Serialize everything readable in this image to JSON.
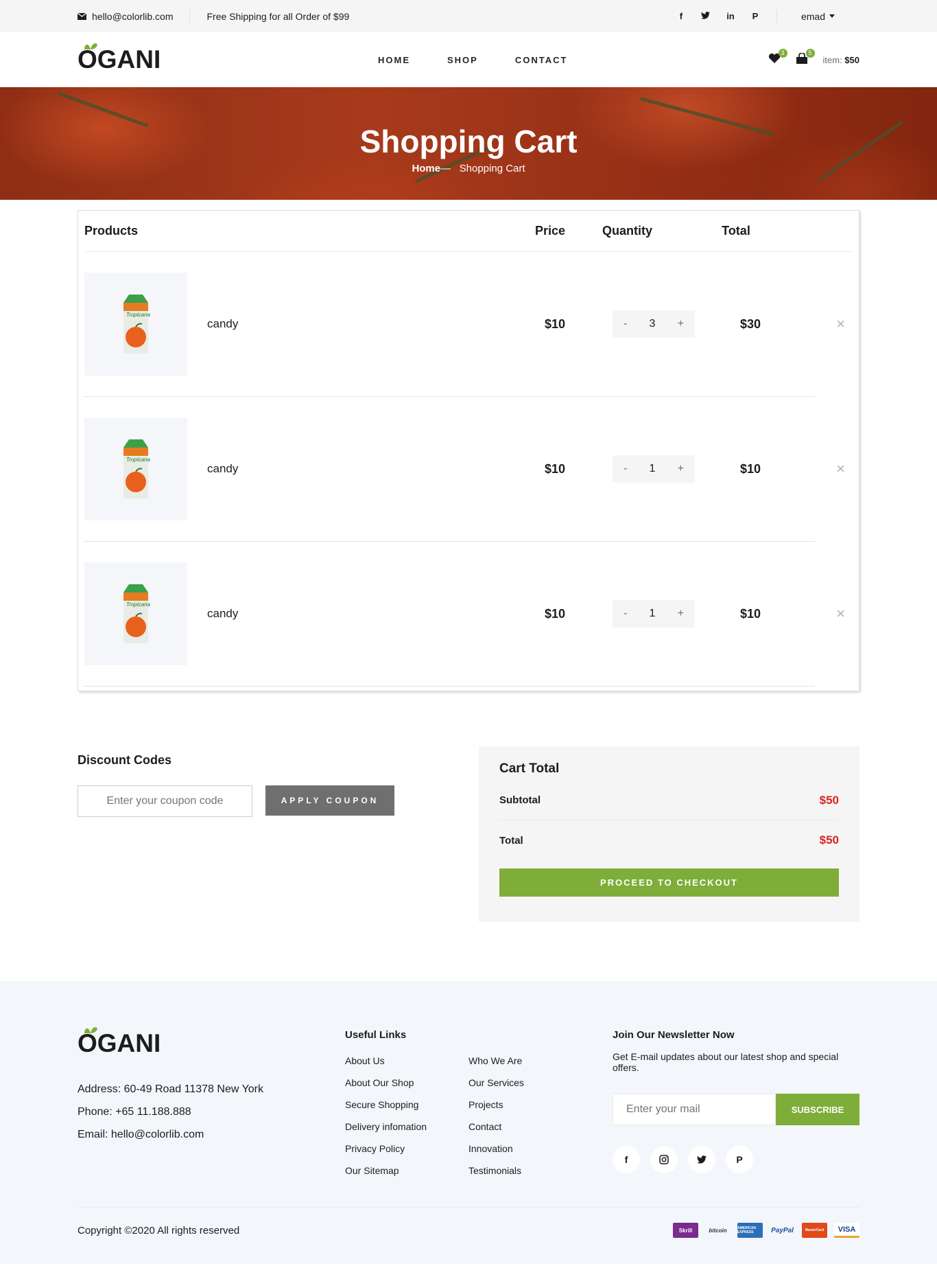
{
  "topbar": {
    "email": "hello@colorlib.com",
    "shipping": "Free Shipping for all Order of $99",
    "social_icons": [
      "facebook-icon",
      "twitter-icon",
      "linkedin-icon",
      "pinterest-icon"
    ],
    "user": "emad"
  },
  "header": {
    "logo": "OGANI",
    "nav": [
      "HOME",
      "SHOP",
      "CONTACT"
    ],
    "wishlist_count": "3",
    "bag_count": "5",
    "item_label": "item:",
    "item_price": "$50"
  },
  "hero": {
    "title": "Shopping Cart",
    "crumb_home": "Home",
    "crumb_sep": "—",
    "crumb_current": "Shopping Cart"
  },
  "cart": {
    "headers": {
      "products": "Products",
      "price": "Price",
      "quantity": "Quantity",
      "total": "Total"
    },
    "rows": [
      {
        "name": "candy",
        "price": "$10",
        "qty": "3",
        "total": "$30"
      },
      {
        "name": "candy",
        "price": "$10",
        "qty": "1",
        "total": "$10"
      },
      {
        "name": "candy",
        "price": "$10",
        "qty": "1",
        "total": "$10"
      }
    ],
    "minus": "-",
    "plus": "+",
    "remove": "×"
  },
  "discount": {
    "title": "Discount Codes",
    "placeholder": "Enter your coupon code",
    "button": "APPLY COUPON"
  },
  "cart_total": {
    "title": "Cart Total",
    "subtotal_label": "Subtotal",
    "subtotal_value": "$50",
    "total_label": "Total",
    "total_value": "$50",
    "checkout": "PROCEED TO CHECKOUT"
  },
  "footer": {
    "logo": "OGANI",
    "address": "Address: 60-49 Road 11378 New York",
    "phone": "Phone: +65 11.188.888",
    "email": "Email: hello@colorlib.com",
    "links_title": "Useful Links",
    "links_col1": [
      "About Us",
      "About Our Shop",
      "Secure Shopping",
      "Delivery infomation",
      "Privacy Policy",
      "Our Sitemap"
    ],
    "links_col2": [
      "Who We Are",
      "Our Services",
      "Projects",
      "Contact",
      "Innovation",
      "Testimonials"
    ],
    "newsletter_title": "Join Our Newsletter Now",
    "newsletter_text": "Get E-mail updates about our latest shop and special offers.",
    "newsletter_placeholder": "Enter your mail",
    "subscribe": "SUBSCRIBE",
    "social_icons": [
      "facebook-icon",
      "instagram-icon",
      "twitter-icon",
      "pinterest-icon"
    ],
    "copyright": "Copyright ©2020 All rights reserved",
    "payments": [
      "Skrill",
      "bitcoin",
      "AMERICAN EXPRESS",
      "PayPal",
      "MasterCard",
      "VISA"
    ]
  },
  "colors": {
    "accent": "#7fad39",
    "price_red": "#dd2222",
    "coupon_button": "#6f6f6f"
  }
}
